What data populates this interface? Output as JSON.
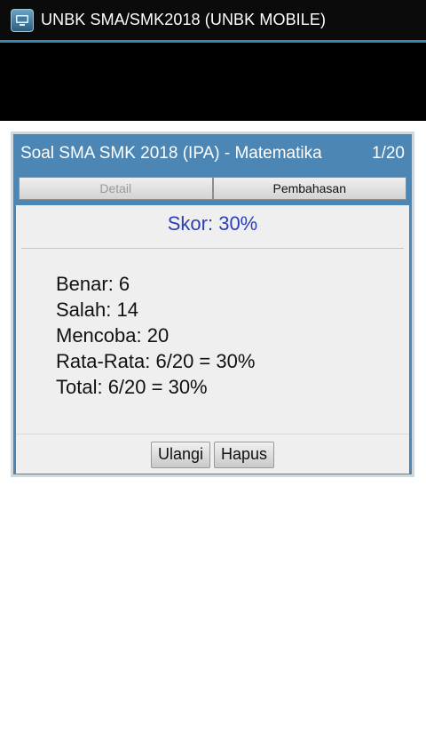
{
  "app": {
    "title": "UNBK SMA/SMK2018 (UNBK MOBILE)",
    "icon": "app-icon"
  },
  "dialog": {
    "title": "Soal SMA SMK 2018 (IPA) - Matematika",
    "page": "1/20",
    "tabs": [
      {
        "label": "Detail",
        "enabled": false
      },
      {
        "label": "Pembahasan",
        "enabled": true
      }
    ],
    "score": "Skor: 30%",
    "stats": [
      "Benar: 6",
      "Salah: 14",
      "Mencoba: 20",
      "Rata-Rata: 6/20 = 30%",
      "Total: 6/20 = 30%"
    ],
    "buttons": {
      "retry": "Ulangi",
      "delete": "Hapus"
    }
  },
  "colors": {
    "header_blue": "#4b86b4",
    "score_blue": "#2c3fb5",
    "titlebar": "#0b0b0b"
  }
}
